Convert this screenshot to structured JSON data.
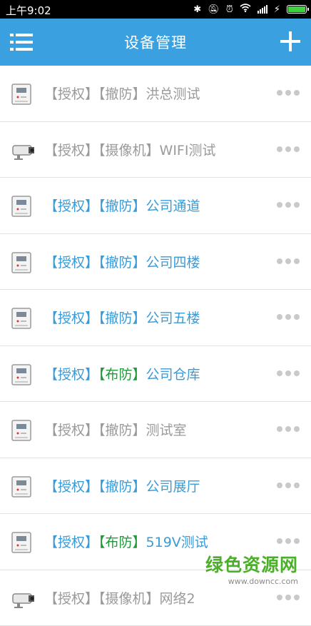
{
  "status_bar": {
    "time": "上午9:02",
    "battery_color": "#3fd13f"
  },
  "header": {
    "title": "设备管理",
    "menu_icon": "list-menu-icon",
    "add_icon": "plus-icon",
    "bg_color": "#3aa0e0"
  },
  "devices": [
    {
      "type": "alarm-panel",
      "status": "offline",
      "auth": "【授权】",
      "mode": "【撤防】",
      "name": "洪总测试"
    },
    {
      "type": "camera",
      "status": "offline",
      "auth": "【授权】",
      "mode": "【摄像机】",
      "name": "WIFI测试"
    },
    {
      "type": "alarm-panel",
      "status": "online",
      "auth": "【授权】",
      "mode": "【撤防】",
      "name": "公司通道"
    },
    {
      "type": "alarm-panel",
      "status": "online",
      "auth": "【授权】",
      "mode": "【撤防】",
      "name": "公司四楼"
    },
    {
      "type": "alarm-panel",
      "status": "online",
      "auth": "【授权】",
      "mode": "【撤防】",
      "name": "公司五楼"
    },
    {
      "type": "alarm-panel",
      "status": "armed",
      "auth": "【授权】",
      "mode": "【布防】",
      "name": "公司仓库"
    },
    {
      "type": "alarm-panel",
      "status": "offline",
      "auth": "【授权】",
      "mode": "【撤防】",
      "name": "测试室"
    },
    {
      "type": "alarm-panel",
      "status": "online",
      "auth": "【授权】",
      "mode": "【撤防】",
      "name": "公司展厅"
    },
    {
      "type": "alarm-panel",
      "status": "armed",
      "auth": "【授权】",
      "mode": "【布防】",
      "name": "519V测试"
    },
    {
      "type": "camera",
      "status": "offline",
      "auth": "【授权】",
      "mode": "【摄像机】",
      "name": "网络2"
    }
  ],
  "colors": {
    "offline": "#9a9a9a",
    "online": "#3a9bd6",
    "armed": "#1f9a3a"
  },
  "watermark": {
    "text": "绿色资源网",
    "url": "www.downcc.com"
  }
}
